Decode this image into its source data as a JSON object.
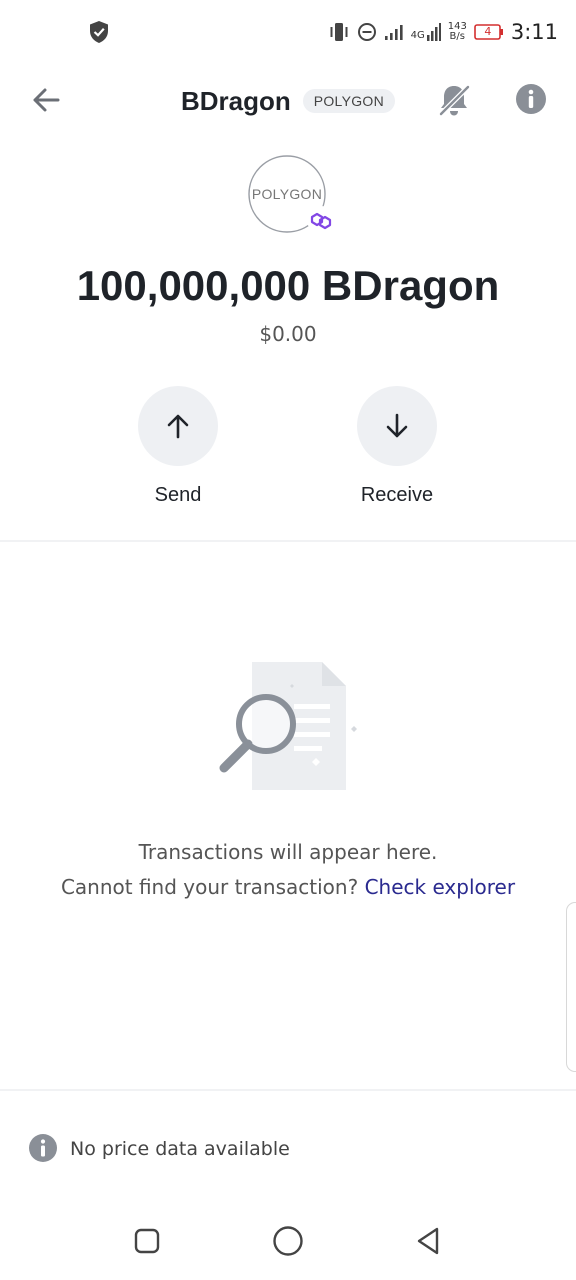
{
  "status_bar": {
    "time": "3:11",
    "network_type": "4G",
    "speed_value": "143",
    "speed_unit": "B/s",
    "battery_level": "4",
    "icons": [
      "shield-icon",
      "vibrate-icon",
      "do-not-disturb-icon",
      "signal-icon",
      "signal-4g-icon",
      "battery-icon"
    ]
  },
  "header": {
    "title": "BDragon",
    "network_badge": "POLYGON",
    "icons": [
      "back-arrow-icon",
      "bell-off-icon",
      "info-icon"
    ]
  },
  "token": {
    "logo_text": "POLYGON",
    "balance": "100,000,000 BDragon",
    "fiat_value": "$0.00"
  },
  "actions": {
    "send_label": "Send",
    "receive_label": "Receive"
  },
  "empty_state": {
    "line1": "Transactions will appear here.",
    "line2_prefix": "Cannot find your transaction?",
    "link_text": "Check explorer"
  },
  "price_info": {
    "text": "No price data available"
  },
  "colors": {
    "text_primary": "#1f2329",
    "circle_bg": "#eef0f3",
    "link": "#2a2a8f",
    "polygon_purple": "#8247e5",
    "battery_low": "#d32f2f"
  }
}
